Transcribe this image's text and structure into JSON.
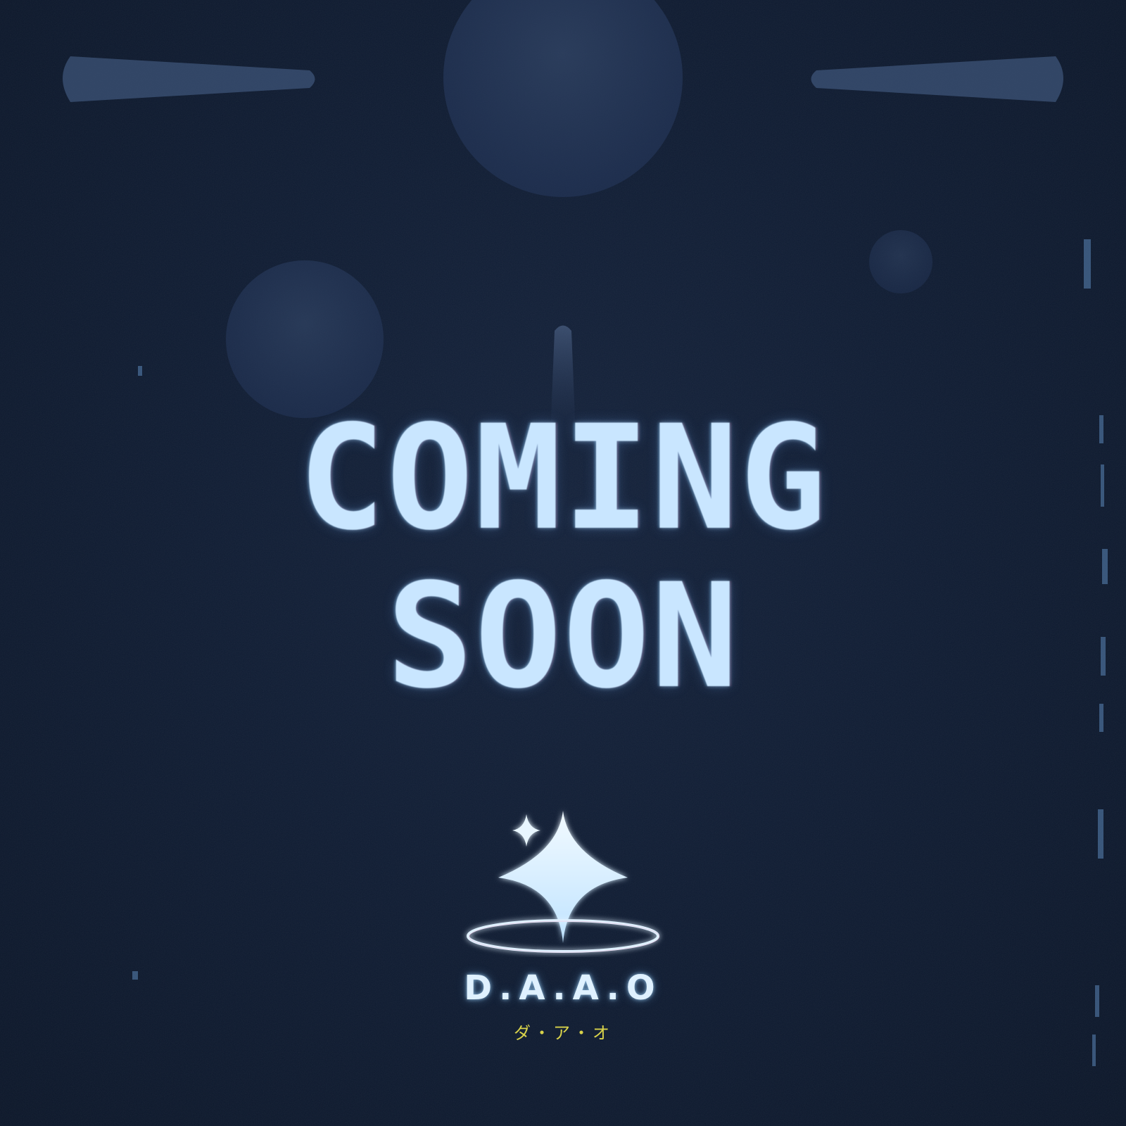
{
  "headline": {
    "line1": "COMING",
    "line2": "SOON"
  },
  "brand": {
    "name": "D.A.A.O",
    "kana": "ダ・ア・オ"
  },
  "colors": {
    "background": "#0f1c33",
    "headline": "#c9e6ff",
    "logo_glow": "#dff1ff",
    "kana": "#d8d24a",
    "orb": "#2e4260"
  },
  "icons": {
    "logo_mark": "sparkle-halo-icon",
    "small_star": "sparkle-icon"
  }
}
